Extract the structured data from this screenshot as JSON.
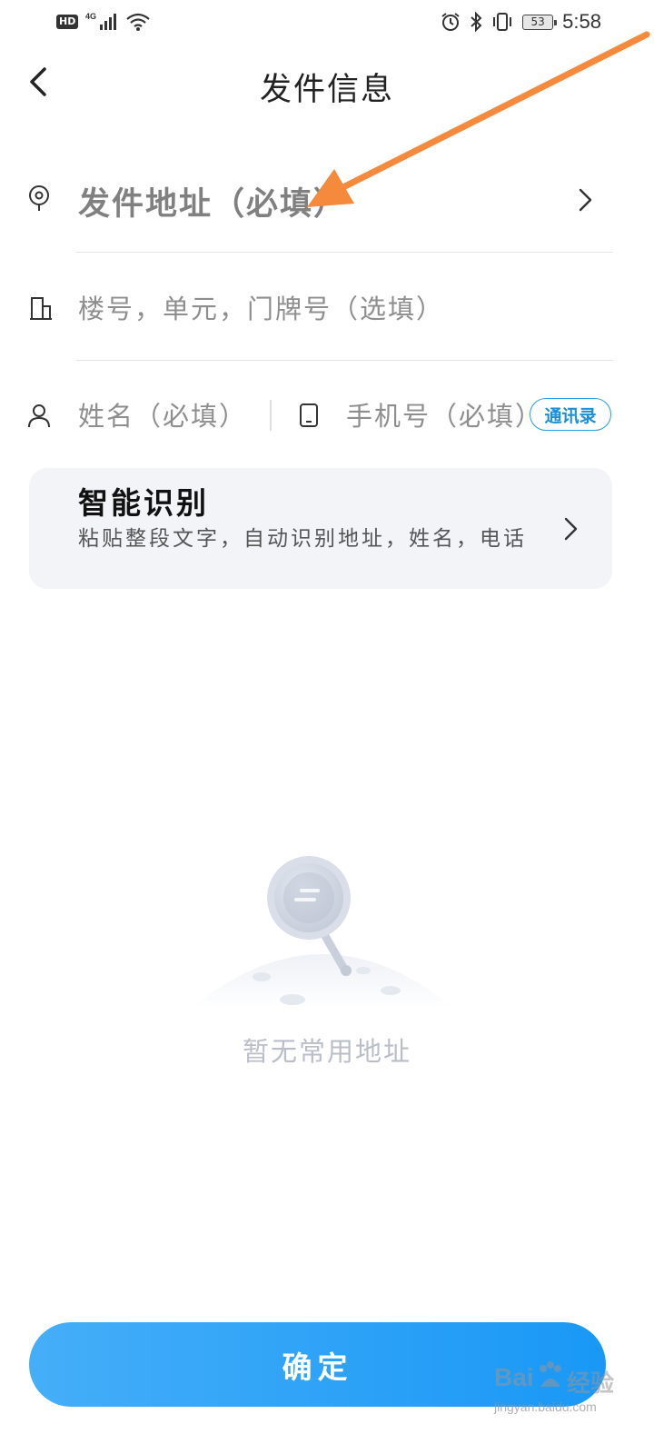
{
  "status_bar": {
    "hd": "HD",
    "network": "4G",
    "battery": "53",
    "time": "5:58"
  },
  "header": {
    "title": "发件信息",
    "back_icon": "chevron-left-icon"
  },
  "form": {
    "address_placeholder": "发件地址（必填）",
    "address_icon": "location-pin-icon",
    "detail_placeholder": "楼号，单元，门牌号（选填）",
    "detail_icon": "building-icon",
    "name_placeholder": "姓名（必填）",
    "name_icon": "person-icon",
    "phone_placeholder": "手机号（必填）",
    "phone_icon": "phone-icon",
    "contacts_label": "通讯录"
  },
  "smart_recognition": {
    "title": "智能识别",
    "description": "粘贴整段文字，自动识别地址，姓名，电话"
  },
  "empty_state": {
    "text": "暂无常用地址",
    "icon": "magnifier-planet-icon"
  },
  "confirm_label": "确定",
  "watermark": {
    "brand": "Bai",
    "brand_word": "经验",
    "url": "jingyan.baidu.com"
  },
  "colors": {
    "accent": "#1998f6",
    "arrow": "#f58a3c",
    "card_bg": "#f3f4f7"
  }
}
